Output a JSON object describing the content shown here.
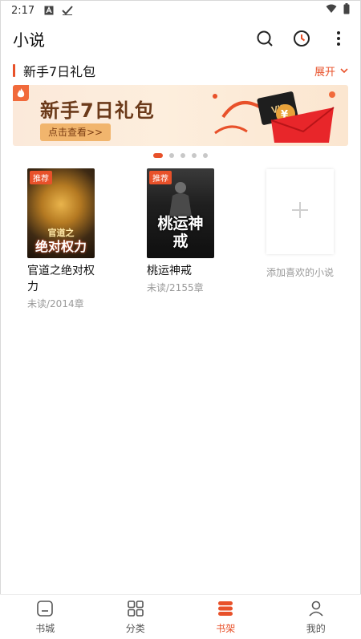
{
  "status_bar": {
    "time": "2:17",
    "icons": [
      "a-icon",
      "check-icon"
    ],
    "right_icons": [
      "wifi-icon",
      "battery-icon"
    ]
  },
  "header": {
    "title": "小说",
    "actions": [
      "search-icon",
      "history-icon",
      "more-icon"
    ]
  },
  "promo": {
    "section_title": "新手7日礼包",
    "expand_label": "展开",
    "banner_title": "新手7日礼包",
    "banner_cta": "点击查看>>",
    "banner_vip": "VIP",
    "carousel_count": 5,
    "carousel_active": 0
  },
  "books": [
    {
      "title": "官道之绝对权力",
      "progress": "未读/2014章",
      "tag": "推荐",
      "cover_title_big": "绝对权力",
      "cover_sub": "官道之"
    },
    {
      "title": "桃运神戒",
      "progress": "未读/2155章",
      "tag": "推荐",
      "cover_title_big": "桃运神戒"
    }
  ],
  "add_slot": {
    "label": "添加喜欢的小说"
  },
  "nav": [
    {
      "label": "书城",
      "icon": "home-icon",
      "active": false
    },
    {
      "label": "分类",
      "icon": "category-icon",
      "active": false
    },
    {
      "label": "书架",
      "icon": "bookshelf-icon",
      "active": true
    },
    {
      "label": "我的",
      "icon": "profile-icon",
      "active": false
    }
  ],
  "colors": {
    "accent": "#e8512a",
    "muted": "#999999"
  }
}
